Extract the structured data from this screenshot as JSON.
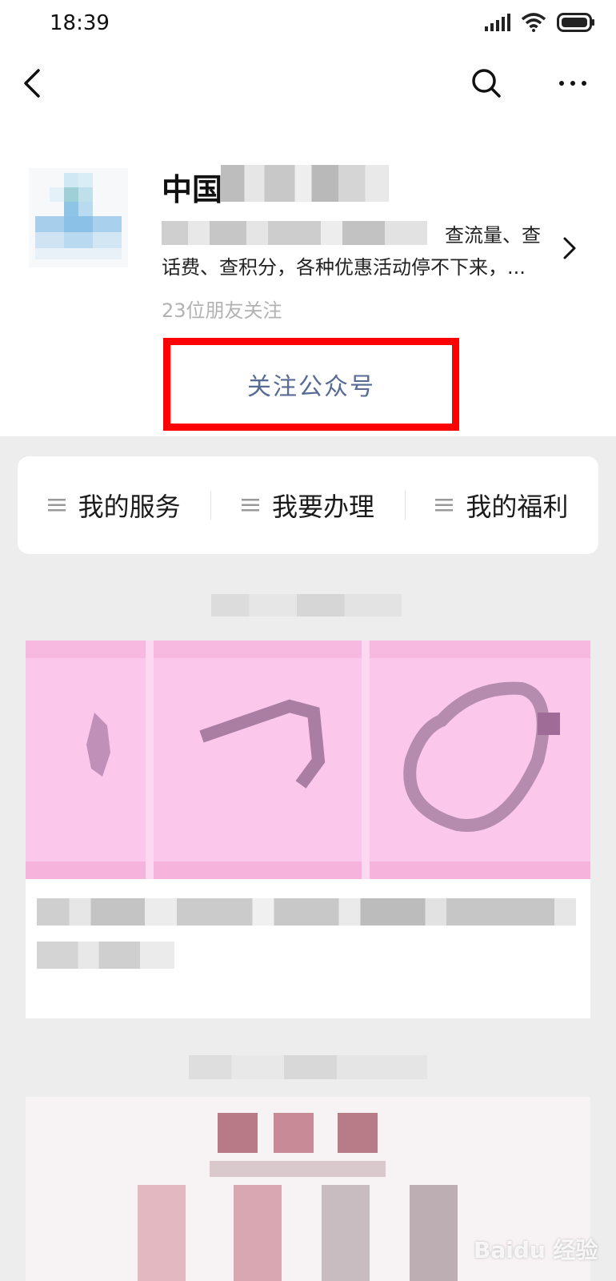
{
  "status_bar": {
    "time": "18:39",
    "signal_icon": "signal-icon",
    "wifi_icon": "wifi-icon",
    "battery_icon": "battery-icon"
  },
  "nav": {
    "back_icon": "back-arrow-icon",
    "search_icon": "search-icon",
    "more_icon": "more-icon"
  },
  "profile": {
    "name_visible": "中国",
    "description_line1": "查流量、查",
    "description_line2": "话费、查积分，各种优惠活动停不下来，...",
    "friends_following": "23位朋友关注",
    "follow_button": "关注公众号"
  },
  "menu": {
    "items": [
      {
        "label": "我的服务"
      },
      {
        "label": "我要办理"
      },
      {
        "label": "我的福利"
      }
    ]
  },
  "colors": {
    "follow_text": "#576b95",
    "highlight_border": "#ff0000",
    "background": "#ededed",
    "banner": "#fbc8ec"
  },
  "watermark": "Baidu 经验"
}
